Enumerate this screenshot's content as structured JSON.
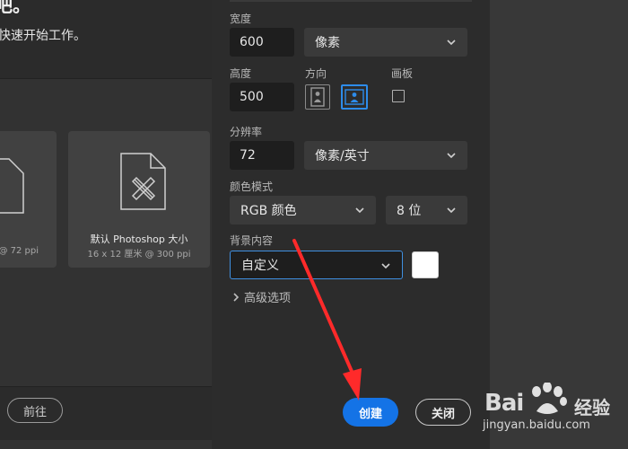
{
  "left": {
    "headline": "吧。",
    "subline": "快速开始工作。",
    "cards": [
      {
        "title": "",
        "subtitle": "@ 72 ppi"
      },
      {
        "title": "默认 Photoshop 大小",
        "subtitle": "16 x 12 厘米 @ 300 ppi"
      }
    ],
    "go_label": "前往"
  },
  "form": {
    "width": {
      "label": "宽度",
      "value": "600",
      "unit": "像素"
    },
    "height": {
      "label": "高度",
      "value": "500"
    },
    "orientation": {
      "label": "方向"
    },
    "artboard": {
      "label": "画板"
    },
    "resolution": {
      "label": "分辨率",
      "value": "72",
      "unit": "像素/英寸"
    },
    "color_mode": {
      "label": "颜色模式",
      "mode": "RGB 颜色",
      "depth": "8 位"
    },
    "background": {
      "label": "背景内容",
      "value": "自定义",
      "swatch_color": "#ffffff"
    },
    "advanced_label": "高级选项",
    "create_label": "创建",
    "close_label": "关闭"
  },
  "colors": {
    "accent": "#1473e6",
    "annotation_arrow": "#ff2a2a"
  },
  "watermark": {
    "brand": "Bai",
    "brand_cn": "经验",
    "url": "jingyan.baidu.com"
  }
}
